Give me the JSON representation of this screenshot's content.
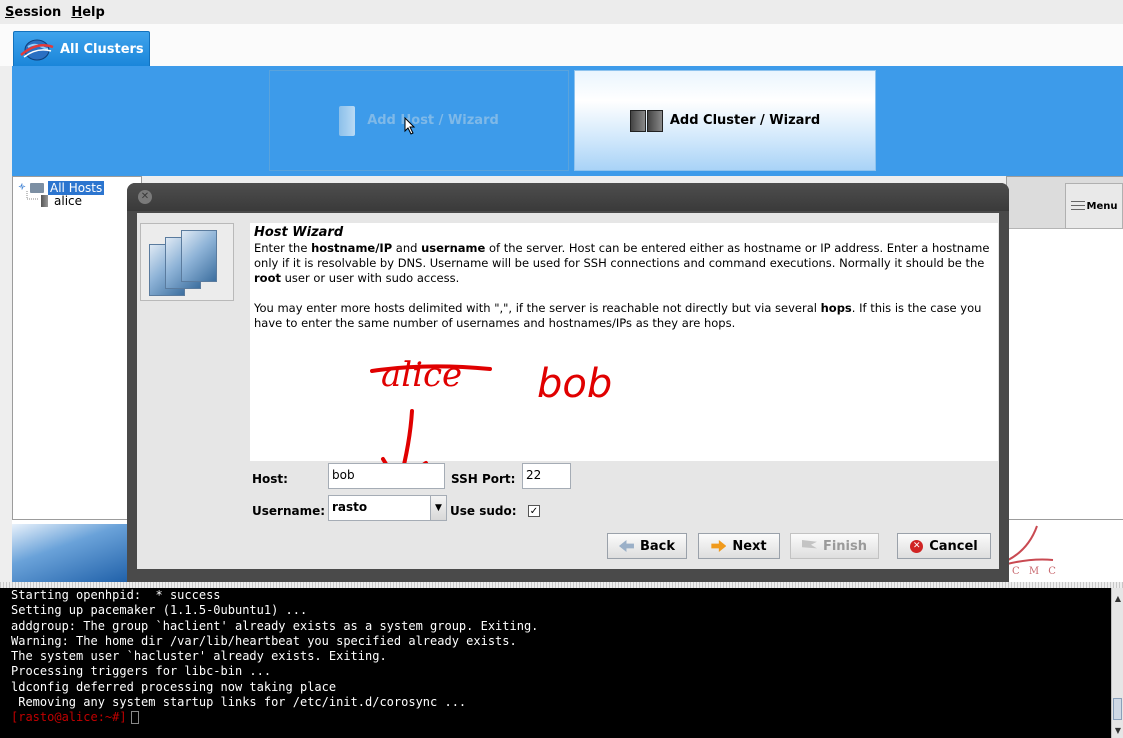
{
  "menubar": {
    "session": "Session",
    "help": "Help"
  },
  "tabs": [
    {
      "label": "All Clusters"
    }
  ],
  "toolbar": {
    "add_host": "Add Host / Wizard",
    "add_cluster": "Add Cluster / Wizard"
  },
  "tree": {
    "root": "All Hosts",
    "host": "alice"
  },
  "right_panel": {
    "menu_label": "Menu"
  },
  "dialog": {
    "title": "Host Wizard",
    "p1_a": "Enter the ",
    "p1_b": "hostname/IP",
    "p1_c": " and ",
    "p1_d": "username",
    "p1_e": " of the server. Host can be entered either as hostname or IP address. Enter a hostname only if it is resolvable by DNS. Username will be used for SSH connections and command executions. Normally it should be the ",
    "p1_f": "root",
    "p1_g": " user or user with sudo access.",
    "p2_a": "You may enter more hosts delimited with \",\", if the server is reachable not directly but via several ",
    "p2_b": "hops",
    "p2_c": ". If this is the case you have to enter the same number of usernames and hostnames/IPs as they are hops.",
    "annotation_strike": "alice",
    "annotation_new": "bob",
    "host_label": "Host:",
    "host_value": "bob",
    "ssh_port_label": "SSH Port:",
    "ssh_port_value": "22",
    "username_label": "Username:",
    "username_value": "rasto",
    "use_sudo_label": "Use sudo:",
    "use_sudo_checked": true,
    "buttons": {
      "back": "Back",
      "next": "Next",
      "finish": "Finish",
      "cancel": "Cancel"
    }
  },
  "bottom_logo_text": "C M C",
  "terminal": {
    "lines": [
      "Starting openhpid:  * success",
      "Setting up pacemaker (1.1.5-0ubuntu1) ...",
      "addgroup: The group `haclient' already exists as a system group. Exiting.",
      "Warning: The home dir /var/lib/heartbeat you specified already exists.",
      "The system user `hacluster' already exists. Exiting.",
      "Processing triggers for libc-bin ...",
      "ldconfig deferred processing now taking place",
      " Removing any system startup links for /etc/init.d/corosync ..."
    ],
    "prompt": "[rasto@alice:~#]"
  },
  "colors": {
    "toolbar_blue": "#3d9bea",
    "annotation_red": "#e00000",
    "tree_selection": "#2c75cf"
  }
}
